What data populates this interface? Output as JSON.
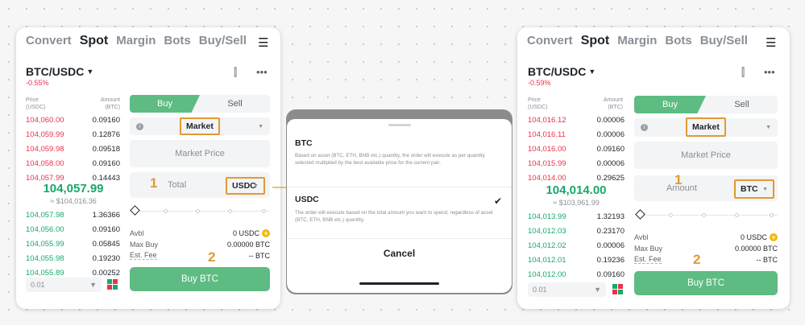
{
  "tabs": [
    "Convert",
    "Spot",
    "Margin",
    "Bots",
    "Buy/Sell"
  ],
  "active_tab": "Spot",
  "icons": {
    "menu": "hamburger-icon",
    "chart": "candlestick-icon",
    "more": "more-dots-icon",
    "info": "info-icon",
    "add": "plus-circle-icon",
    "check": "checkmark-icon",
    "layout": "orderbook-layout-icon"
  },
  "colors": {
    "accent_green": "#5ebc82",
    "bid_green": "#17a96a",
    "ask_red": "#e8334b",
    "highlight_orange": "#e19a33",
    "coin_yellow": "#f0b90b"
  },
  "left": {
    "pair": "BTC/USDC",
    "change": "-0.55%",
    "price_header": "Price\n(USDC)",
    "amount_header": "Amount\n(BTC)",
    "asks": [
      {
        "price": "104,060.00",
        "amount": "0.09160"
      },
      {
        "price": "104,059.99",
        "amount": "0.12876"
      },
      {
        "price": "104,059.98",
        "amount": "0.09518"
      },
      {
        "price": "104,058.00",
        "amount": "0.09160"
      },
      {
        "price": "104,057.99",
        "amount": "0.14443"
      }
    ],
    "mid_price": "104,057.99",
    "mid_usd": "≈ $104,016.36",
    "bids": [
      {
        "price": "104,057.98",
        "amount": "1.36366"
      },
      {
        "price": "104,056.00",
        "amount": "0.09160"
      },
      {
        "price": "104,055.99",
        "amount": "0.05845"
      },
      {
        "price": "104,055.98",
        "amount": "0.19230"
      },
      {
        "price": "104,055.89",
        "amount": "0.00252"
      }
    ],
    "depth": "0.01",
    "buy_tab": "Buy",
    "sell_tab": "Sell",
    "order_type": "Market",
    "market_price_placeholder": "Market Price",
    "qty_label": "Total",
    "qty_unit": "USDC",
    "step1": "1",
    "step2": "2",
    "avbl_label": "Avbl",
    "avbl_value": "0 USDC",
    "maxbuy_label": "Max Buy",
    "maxbuy_value": "0.00000 BTC",
    "fee_label": "Est. Fee",
    "fee_value": "-- BTC",
    "buy_button": "Buy BTC"
  },
  "modal": {
    "option1_title": "BTC",
    "option1_desc": "Based on asset (BTC, ETH, BNB etc.) quantity, the order will execute as per quantity selected multiplied by the best available price for the current pair.",
    "option2_title": "USDC",
    "option2_desc": "The order will execute based on the total amount you want to spend, regardless of asset (BTC, ETH, BNB etc.) quantity.",
    "selected": "USDC",
    "check": "✔",
    "cancel": "Cancel"
  },
  "right": {
    "pair": "BTC/USDC",
    "change": "-0.59%",
    "price_header": "Price\n(USDC)",
    "amount_header": "Amount\n(BTC)",
    "asks": [
      {
        "price": "104,016.12",
        "amount": "0.00006"
      },
      {
        "price": "104,016.11",
        "amount": "0.00006"
      },
      {
        "price": "104,016.00",
        "amount": "0.09160"
      },
      {
        "price": "104,015.99",
        "amount": "0.00006"
      },
      {
        "price": "104,014.00",
        "amount": "0.29625"
      }
    ],
    "mid_price": "104,014.00",
    "mid_usd": "≈ $103,961.99",
    "bids": [
      {
        "price": "104,013.99",
        "amount": "1.32193"
      },
      {
        "price": "104,012.03",
        "amount": "0.23170"
      },
      {
        "price": "104,012.02",
        "amount": "0.00006"
      },
      {
        "price": "104,012.01",
        "amount": "0.19236"
      },
      {
        "price": "104,012.00",
        "amount": "0.09160"
      }
    ],
    "depth": "0.01",
    "buy_tab": "Buy",
    "sell_tab": "Sell",
    "order_type": "Market",
    "market_price_placeholder": "Market Price",
    "qty_label": "Amount",
    "qty_unit": "BTC",
    "step1": "1",
    "step2": "2",
    "avbl_label": "Avbl",
    "avbl_value": "0 USDC",
    "maxbuy_label": "Max Buy",
    "maxbuy_value": "0.00000 BTC",
    "fee_label": "Est. Fee",
    "fee_value": "-- BTC",
    "buy_button": "Buy BTC"
  }
}
